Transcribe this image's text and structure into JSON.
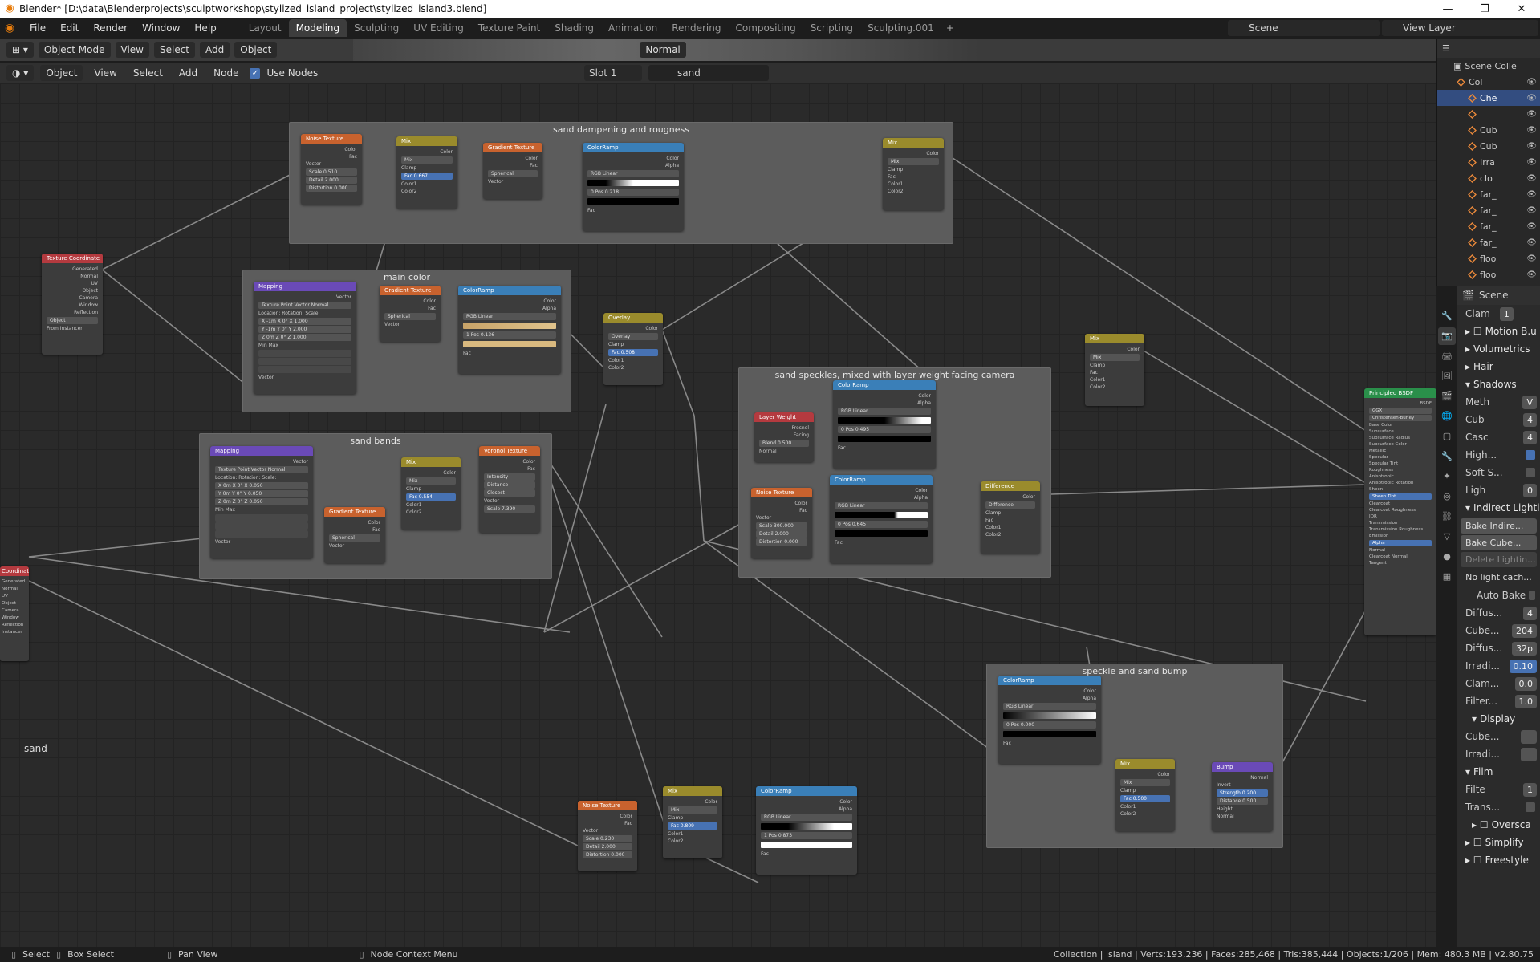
{
  "window": {
    "title": "Blender* [D:\\data\\Blenderprojects\\sculptworkshop\\stylized_island_project\\stylized_island3.blend]",
    "controls": [
      "—",
      "❐",
      "✕"
    ]
  },
  "menubar": {
    "menus": [
      "File",
      "Edit",
      "Render",
      "Window",
      "Help"
    ],
    "workspaces": [
      "Layout",
      "Modeling",
      "Sculpting",
      "UV Editing",
      "Texture Paint",
      "Shading",
      "Animation",
      "Rendering",
      "Compositing",
      "Scripting",
      "Sculpting.001"
    ],
    "active_workspace": "Modeling",
    "scene": "Scene",
    "view_layer": "View Layer"
  },
  "viewport_header": {
    "mode": "Object Mode",
    "items": [
      "View",
      "Select",
      "Add",
      "Object"
    ],
    "orientation": "Normal"
  },
  "node_header": {
    "object_type": "Object",
    "items": [
      "View",
      "Select",
      "Add",
      "Node"
    ],
    "use_nodes_label": "Use Nodes",
    "use_nodes_checked": true,
    "slot": "Slot 1",
    "material": "sand"
  },
  "frames": [
    {
      "label": "sand dampening and rougness"
    },
    {
      "label": "main color"
    },
    {
      "label": "sand bands"
    },
    {
      "label": "sand speckles, mixed with layer weight facing camera"
    },
    {
      "label": "speckle and sand bump"
    }
  ],
  "nodes": {
    "noise1": {
      "title": "Noise Texture",
      "rows": [
        "Color",
        "Fac",
        "Vector",
        "Scale 0.510",
        "Detail 2.000",
        "Distortion 0.000"
      ]
    },
    "mix1": {
      "title": "Mix",
      "rows": [
        "Color",
        "Mix",
        "Clamp",
        "Fac 0.667",
        "Color1",
        "Color2"
      ]
    },
    "grad1": {
      "title": "Gradient Texture",
      "rows": [
        "Color",
        "Fac",
        "Spherical",
        "Vector"
      ]
    },
    "ramp1": {
      "title": "ColorRamp",
      "rows": [
        "Color",
        "Alpha",
        "RGB  Linear",
        "0   Pos 0.218",
        "Fac"
      ]
    },
    "mix2": {
      "title": "Mix",
      "rows": [
        "Color",
        "Mix",
        "Clamp",
        "Fac",
        "Color1",
        "Color2"
      ]
    },
    "texcoord1": {
      "title": "Texture Coordinate",
      "rows": [
        "Generated",
        "Normal",
        "UV",
        "Object",
        "Camera",
        "Window",
        "Reflection",
        "Object",
        "From Instancer"
      ]
    },
    "mapping1": {
      "title": "Mapping",
      "rows": [
        "Vector",
        "Texture Point Vector Normal",
        "Location: Rotation: Scale:",
        "X -1m  X 0°  X 1.000",
        "Y -1m  Y 0°  Y 2.000",
        "Z 0m  Z 0°  Z 1.000",
        "Min  Max",
        "Vector"
      ]
    },
    "grad2": {
      "title": "Gradient Texture",
      "rows": [
        "Color",
        "Fac",
        "Spherical",
        "Vector"
      ]
    },
    "ramp2": {
      "title": "ColorRamp",
      "rows": [
        "Color",
        "Alpha",
        "RGB  Linear",
        "1   Pos 0.136",
        "Fac"
      ]
    },
    "overlay": {
      "title": "Overlay",
      "rows": [
        "Color",
        "Overlay",
        "Clamp",
        "Fac 0.508",
        "Color1",
        "Color2"
      ]
    },
    "mapping2": {
      "title": "Mapping",
      "rows": [
        "Vector",
        "Texture Point Vector Normal",
        "Location: Rotation: Scale:",
        "X 0m  X 0°  X 0.050",
        "Y 0m  Y 0°  Y 0.050",
        "Z 0m  Z 0°  Z 0.050",
        "Min  Max",
        "Vector"
      ]
    },
    "grad3": {
      "title": "Gradient Texture",
      "rows": [
        "Color",
        "Fac",
        "Spherical",
        "Vector"
      ]
    },
    "mix3": {
      "title": "Mix",
      "rows": [
        "Color",
        "Mix",
        "Clamp",
        "Fac 0.554",
        "Color1",
        "Color2"
      ]
    },
    "voronoi": {
      "title": "Voronoi Texture",
      "rows": [
        "Color",
        "Fac",
        "Intensity",
        "Distance",
        "Closest",
        "Vector",
        "Scale 7.390"
      ]
    },
    "layerweight": {
      "title": "Layer Weight",
      "rows": [
        "Fresnel",
        "Facing",
        "Blend 0.500",
        "Normal"
      ]
    },
    "ramp3": {
      "title": "ColorRamp",
      "rows": [
        "Color",
        "Alpha",
        "RGB  Linear",
        "0   Pos 0.495",
        "Fac"
      ]
    },
    "noise2": {
      "title": "Noise Texture",
      "rows": [
        "Color",
        "Fac",
        "Vector",
        "Scale 300.000",
        "Detail 2.000",
        "Distortion 0.000"
      ]
    },
    "ramp4": {
      "title": "ColorRamp",
      "rows": [
        "Color",
        "Alpha",
        "RGB  Linear",
        "0   Pos 0.645",
        "Fac"
      ]
    },
    "difference": {
      "title": "Difference",
      "rows": [
        "Color",
        "Difference",
        "Clamp",
        "Fac",
        "Color1",
        "Color2"
      ]
    },
    "mix4": {
      "title": "Mix",
      "rows": [
        "Color",
        "Mix",
        "Clamp",
        "Fac",
        "Color1",
        "Color2"
      ]
    },
    "bsdf": {
      "title": "Principled BSDF",
      "rows": [
        "BSDF",
        "GGX",
        "Christensen-Burley",
        "Base Color",
        "Subsurface",
        "Subsurface Radius",
        "Subsurface Color",
        "Metallic",
        "Specular",
        "Specular Tint",
        "Roughness",
        "Anisotropic",
        "Anisotropic Rotation",
        "Sheen",
        "Sheen Tint",
        "Clearcoat",
        "Clearcoat Roughness",
        "IOR",
        "Transmission",
        "Transmission Roughness",
        "Emission",
        "Alpha",
        "Normal",
        "Clearcoat Normal",
        "Tangent"
      ]
    },
    "texcoord2": {
      "title": "Coordinate",
      "rows": [
        "Generated",
        "Normal",
        "UV",
        "Object",
        "Camera",
        "Window",
        "Reflection",
        "Instancer"
      ]
    },
    "ramp5": {
      "title": "ColorRamp",
      "rows": [
        "Color",
        "Alpha",
        "RGB  Linear",
        "0   Pos 0.000",
        "Fac"
      ]
    },
    "mix5": {
      "title": "Mix",
      "rows": [
        "Color",
        "Mix",
        "Clamp",
        "Fac 0.500",
        "Color1",
        "Color2"
      ]
    },
    "bump": {
      "title": "Bump",
      "rows": [
        "Normal",
        "Invert",
        "Strength 0.200",
        "Distance 0.500",
        "Height",
        "Normal"
      ]
    },
    "noise3": {
      "title": "Noise Texture",
      "rows": [
        "Color",
        "Fac",
        "Vector",
        "Scale 0.230",
        "Detail 2.000",
        "Distortion 0.000"
      ]
    },
    "mix6": {
      "title": "Mix",
      "rows": [
        "Color",
        "Mix",
        "Clamp",
        "Fac 0.809",
        "Color1",
        "Color2"
      ]
    },
    "ramp6": {
      "title": "ColorRamp",
      "rows": [
        "Color",
        "Alpha",
        "RGB  Linear",
        "1   Pos 0.873",
        "Fac"
      ]
    }
  },
  "canvas_label": "sand",
  "outliner": {
    "title": "Scene Colle",
    "rows": [
      "Col",
      "Che",
      "",
      "Cub",
      "Cub",
      "Irra",
      "clo",
      "far_",
      "far_",
      "far_",
      "far_",
      "floo",
      "floo"
    ]
  },
  "properties": {
    "header": "Scene",
    "rows": {
      "clamp_label": "Clam",
      "clamp_value": "1",
      "motion": "Motion B.u",
      "volumetrics": "Volumetrics",
      "hair": "Hair",
      "shadows": "Shadows",
      "method_label": "Meth",
      "method_value": "V",
      "cube_label": "Cub",
      "cube_value": "4",
      "cascade_label": "Casc",
      "cascade_value": "4",
      "high_label": "High...",
      "soft_label": "Soft S...",
      "light_label": "Ligh",
      "light_value": "0",
      "indirect": "Indirect Lightin",
      "bake_indirect": "Bake Indire...",
      "bake_cube": "Bake Cube...",
      "delete_lighting": "Delete Lightin...",
      "no_light_cache": "No light cach...",
      "auto_bake": "Auto Bake",
      "diffuse_label": "Diffus...",
      "diffuse_value": "4",
      "cubemap_label": "Cube...",
      "cubemap_value": "204",
      "diffuse2_label": "Diffus...",
      "diffuse2_value": "32p",
      "irradiance_label": "Irradi...",
      "irradiance_value": "0.10",
      "clamp2_label": "Clam...",
      "clamp2_value": "0.0",
      "filter_label": "Filter...",
      "filter_value": "1.0",
      "display": "Display",
      "disp_cube": "Cube...",
      "disp_irr": "Irradi...",
      "film": "Film",
      "filter_size_label": "Filte",
      "filter_size_value": "1",
      "trans_label": "Trans...",
      "overscan": "Oversca",
      "simplify": "Simplify",
      "freestyle": "Freestyle"
    }
  },
  "statusbar": {
    "select": "Select",
    "box_select": "Box Select",
    "pan_view": "Pan View",
    "node_context": "Node Context Menu",
    "stats": "Collection | island | Verts:193,236 | Faces:285,468 | Tris:385,444 | Objects:1/206 | Mem: 480.3 MB | v2.80.75"
  },
  "colors": {
    "accent": "#4772b3",
    "blender_orange": "#e87d0d",
    "texture_header": "#c8622e",
    "converter_header": "#3a7fb8",
    "color_header": "#9a8b2c",
    "vector_header": "#6a4ab7",
    "input_header": "#b43a3f",
    "shader_header": "#2a8f4a"
  }
}
